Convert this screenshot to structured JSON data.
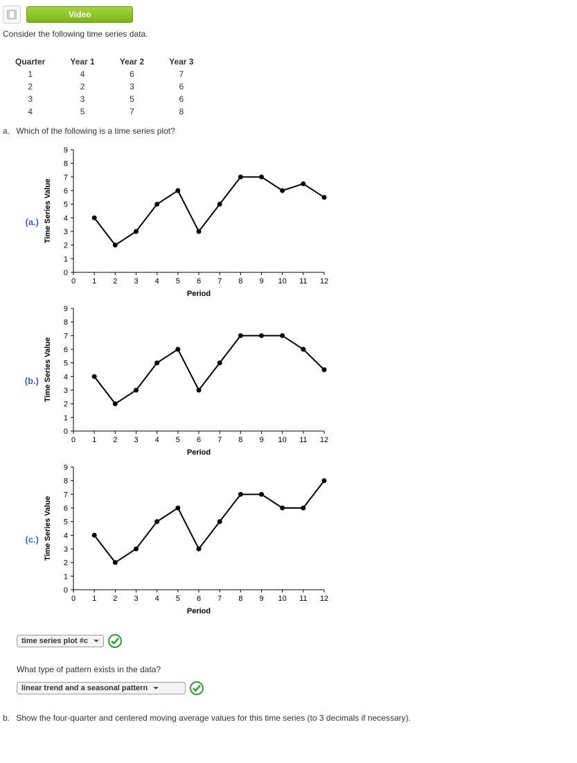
{
  "header": {
    "video_label": "Video"
  },
  "intro": "Consider the following time series data.",
  "table": {
    "headers": [
      "Quarter",
      "Year 1",
      "Year 2",
      "Year 3"
    ],
    "rows": [
      [
        "1",
        "4",
        "6",
        "7"
      ],
      [
        "2",
        "2",
        "3",
        "6"
      ],
      [
        "3",
        "3",
        "5",
        "6"
      ],
      [
        "4",
        "5",
        "7",
        "8"
      ]
    ]
  },
  "question_a_marker": "a.",
  "question_a_text": "Which of the following is a time series plot?",
  "chart_labels": {
    "a": "(a.)",
    "b": "(b.)",
    "c": "(c.)"
  },
  "chart_data": [
    {
      "type": "line",
      "label": "a",
      "x": [
        1,
        2,
        3,
        4,
        5,
        6,
        7,
        8,
        9,
        10,
        11,
        12
      ],
      "values": [
        4,
        2,
        3,
        5,
        6,
        3,
        5,
        7,
        7,
        6,
        6.5,
        5.5
      ],
      "xlabel": "Period",
      "ylabel": "Time Series Value",
      "xlim": [
        0,
        12
      ],
      "ylim": [
        0,
        9
      ],
      "xticks": [
        0,
        1,
        2,
        3,
        4,
        5,
        6,
        7,
        8,
        9,
        10,
        11,
        12
      ],
      "yticks": [
        0,
        1,
        2,
        3,
        4,
        5,
        6,
        7,
        8,
        9
      ]
    },
    {
      "type": "line",
      "label": "b",
      "x": [
        1,
        2,
        3,
        4,
        5,
        6,
        7,
        8,
        9,
        10,
        11,
        12
      ],
      "values": [
        4,
        2,
        3,
        5,
        6,
        3,
        5,
        7,
        7,
        7,
        6,
        4.5
      ],
      "xlabel": "Period",
      "ylabel": "Time Series Value",
      "xlim": [
        0,
        12
      ],
      "ylim": [
        0,
        9
      ],
      "xticks": [
        0,
        1,
        2,
        3,
        4,
        5,
        6,
        7,
        8,
        9,
        10,
        11,
        12
      ],
      "yticks": [
        0,
        1,
        2,
        3,
        4,
        5,
        6,
        7,
        8,
        9
      ]
    },
    {
      "type": "line",
      "label": "c",
      "x": [
        1,
        2,
        3,
        4,
        5,
        6,
        7,
        8,
        9,
        10,
        11,
        12
      ],
      "values": [
        4,
        2,
        3,
        5,
        6,
        3,
        5,
        7,
        7,
        6,
        6,
        8
      ],
      "xlabel": "Period",
      "ylabel": "Time Series Value",
      "xlim": [
        0,
        12
      ],
      "ylim": [
        0,
        9
      ],
      "xticks": [
        0,
        1,
        2,
        3,
        4,
        5,
        6,
        7,
        8,
        9,
        10,
        11,
        12
      ],
      "yticks": [
        0,
        1,
        2,
        3,
        4,
        5,
        6,
        7,
        8,
        9
      ]
    }
  ],
  "select1_value": "time series plot #c",
  "sub_question_text": "What type of pattern exists in the data?",
  "select2_value": "linear trend and a seasonal pattern",
  "question_b_marker": "b.",
  "question_b_text": "Show the four-quarter and centered moving average values for this time series (to 3 decimals if necessary)."
}
